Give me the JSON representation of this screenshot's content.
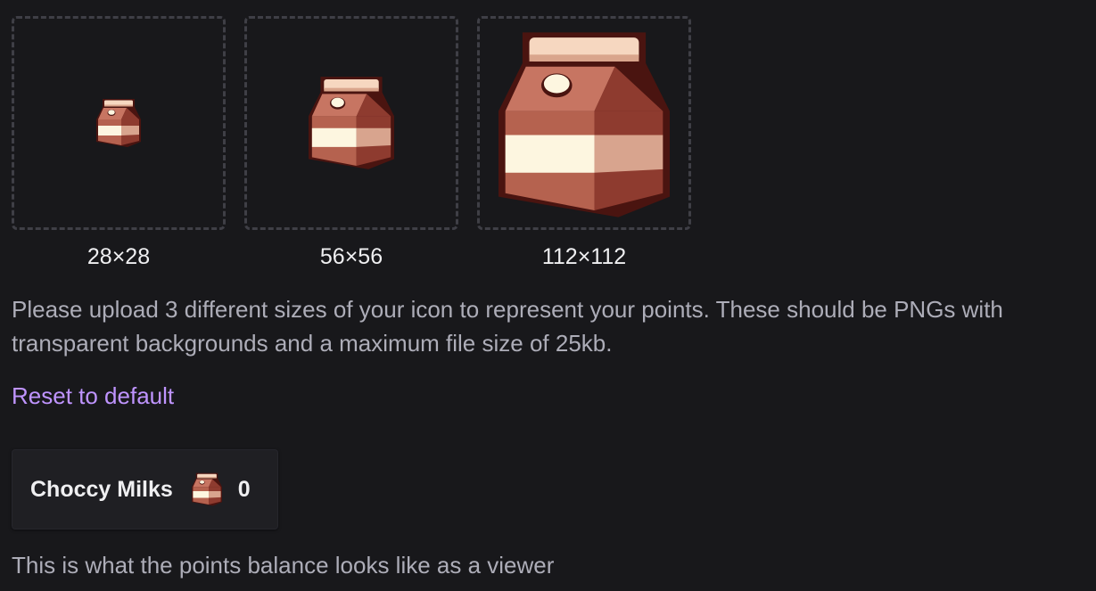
{
  "icons": [
    {
      "size_label": "28×28",
      "icon": "milk-carton-icon"
    },
    {
      "size_label": "56×56",
      "icon": "milk-carton-icon"
    },
    {
      "size_label": "112×112",
      "icon": "milk-carton-icon"
    }
  ],
  "help_text": "Please upload 3 different sizes of your icon to represent your points. These should be PNGs with transparent backgrounds and a maximum file size of 25kb.",
  "reset_link": "Reset to default",
  "preview": {
    "points_name": "Choccy Milks",
    "icon": "milk-carton-icon",
    "points_value": "0"
  },
  "caption": "This is what the points balance looks like as a viewer",
  "colors": {
    "background": "#18181b",
    "accent_link": "#bf94ff",
    "carton_body": "#b5624f",
    "carton_label": "#fdf6e0",
    "carton_outline": "#4a1410"
  }
}
